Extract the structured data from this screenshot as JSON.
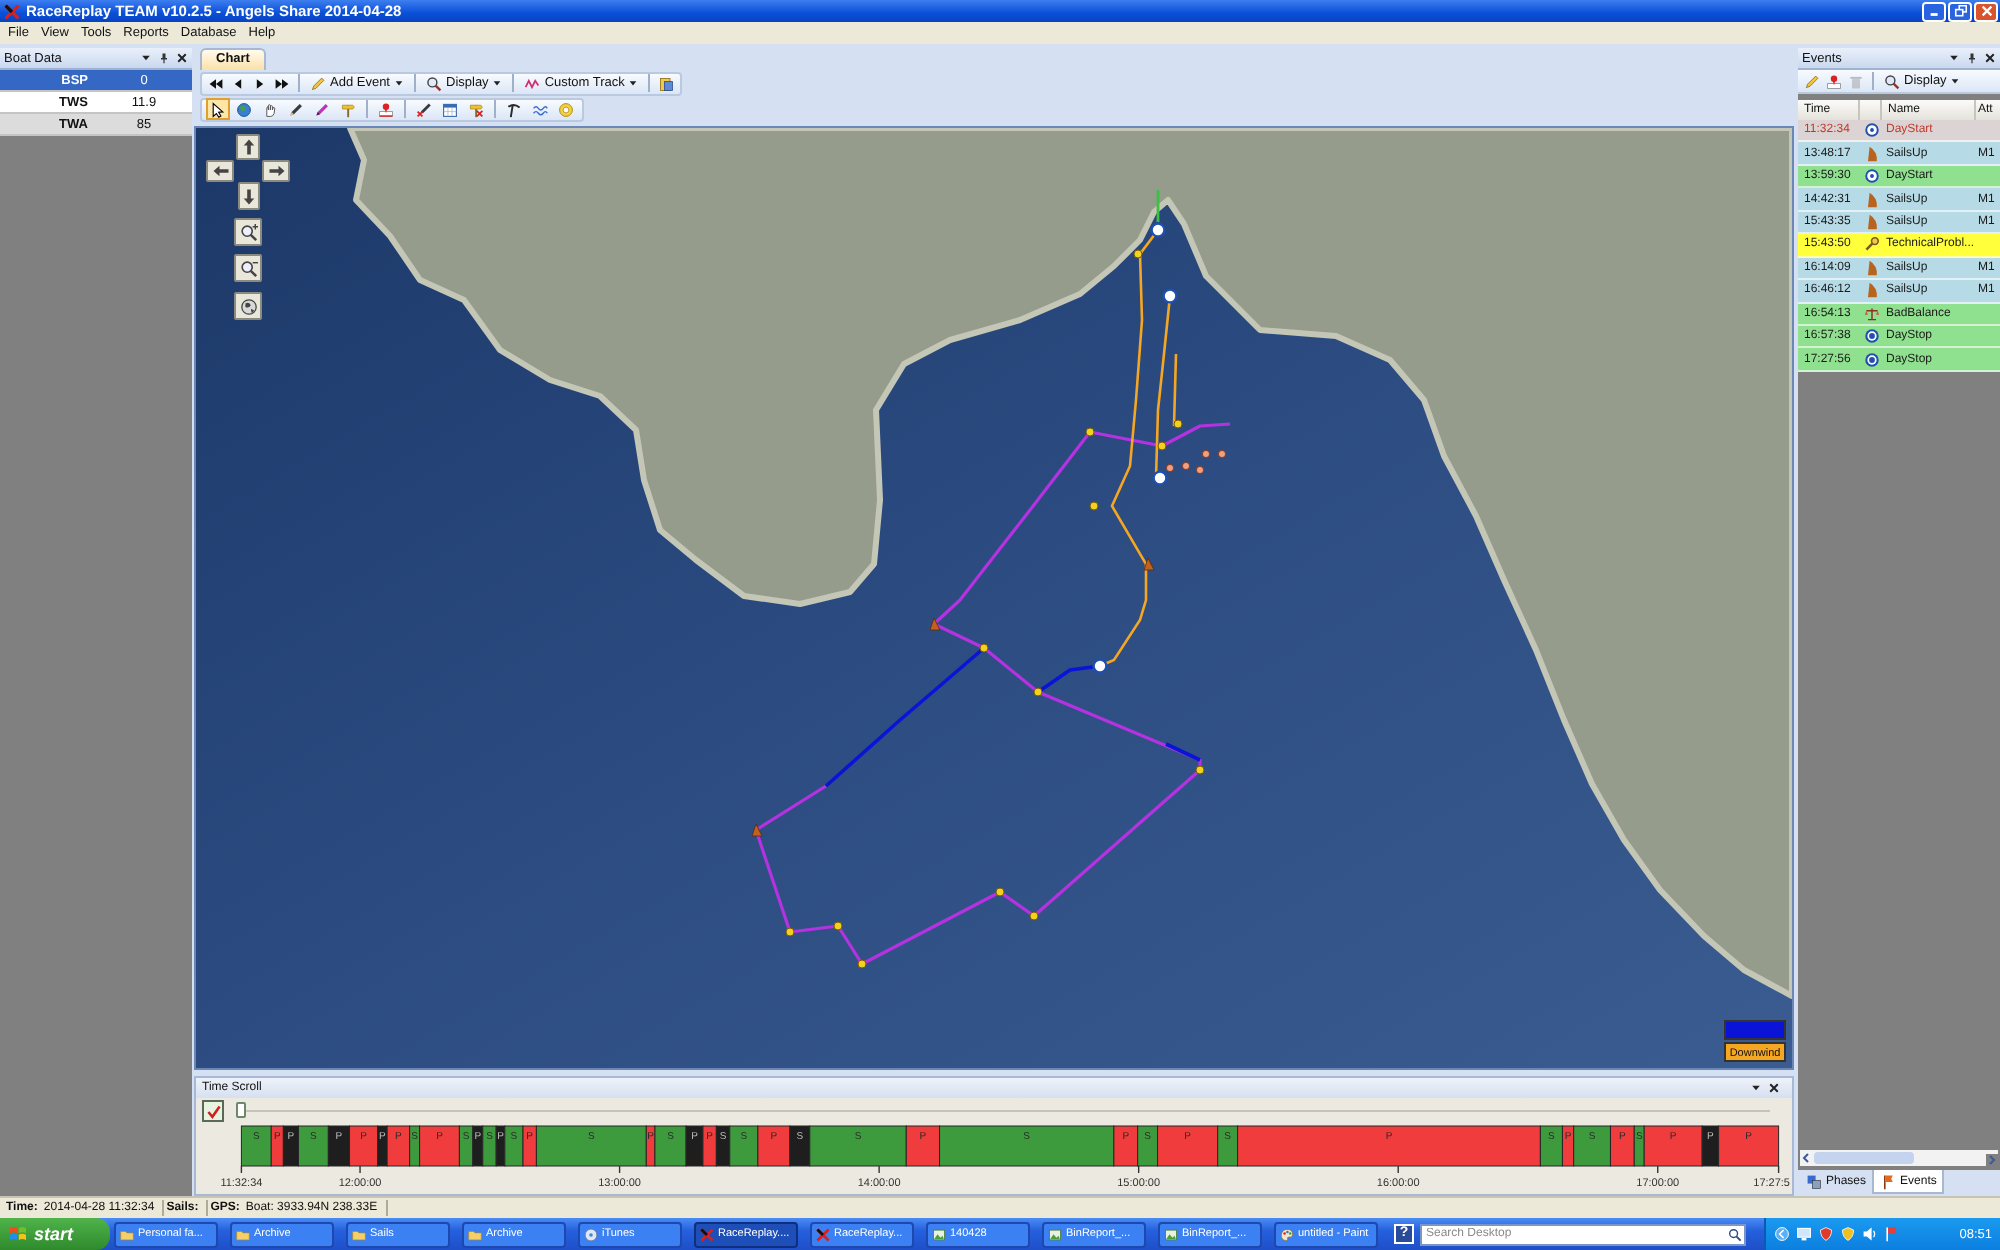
{
  "window": {
    "title": "RaceReplay TEAM v10.2.5 - Angels Share 2014-04-28"
  },
  "menu": [
    "File",
    "View",
    "Tools",
    "Reports",
    "Database",
    "Help"
  ],
  "boat_data": {
    "title": "Boat Data",
    "rows": [
      {
        "label": "BSP",
        "value": "0",
        "selected": true
      },
      {
        "label": "TWS",
        "value": "11.9",
        "selected": false
      },
      {
        "label": "TWA",
        "value": "85",
        "selected": false
      }
    ]
  },
  "chart": {
    "tabs": [
      {
        "label": "Chart",
        "selected": true
      }
    ],
    "nav_buttons": [
      {
        "kind": "first"
      },
      {
        "kind": "previous"
      },
      {
        "kind": "next"
      },
      {
        "kind": "last"
      }
    ],
    "menu_buttons": [
      {
        "label": "Add Event",
        "kind": "pencil"
      },
      {
        "label": "Display",
        "kind": "display"
      },
      {
        "label": "Custom Track",
        "kind": "track"
      }
    ],
    "extra_buttons": [
      {
        "kind": "clipboard"
      }
    ],
    "tool_groups": [
      [
        {
          "kind": "pointer",
          "selected": true
        },
        {
          "kind": "globe",
          "selected": false
        },
        {
          "kind": "hand",
          "selected": false
        },
        {
          "kind": "pencil",
          "selected": false
        },
        {
          "kind": "marker",
          "selected": false
        },
        {
          "kind": "signpost",
          "selected": false
        }
      ],
      [
        {
          "kind": "pin",
          "selected": false
        }
      ],
      [
        {
          "kind": "pencil-cross",
          "selected": false
        },
        {
          "kind": "calendar",
          "selected": false
        },
        {
          "kind": "signpost-cross",
          "selected": false
        }
      ],
      [
        {
          "kind": "pick",
          "selected": false
        },
        {
          "kind": "wave",
          "selected": false
        },
        {
          "kind": "target",
          "selected": false
        }
      ]
    ],
    "map": {
      "legend": [
        {
          "color": "#0a14d6"
        },
        {
          "label": "Downwind",
          "color": "#f5a623"
        }
      ]
    }
  },
  "time_scroll": {
    "title": "Time Scroll",
    "check_button": {
      "checked": true
    },
    "slider": {
      "level": 0
    },
    "timeline": {
      "segments": [
        {
          "label": "S",
          "color": "#3d9a3d"
        },
        {
          "label": "P",
          "color": "#f03c3c"
        },
        {
          "label": "P",
          "color": "#1e1e1e"
        },
        {
          "label": "S",
          "color": "#3d9a3d"
        },
        {
          "label": "P",
          "color": "#1e1e1e"
        },
        {
          "label": "P",
          "color": "#f03c3c"
        },
        {
          "label": "P",
          "color": "#1e1e1e"
        },
        {
          "label": "P",
          "color": "#f03c3c"
        },
        {
          "label": "S",
          "color": "#3d9a3d"
        },
        {
          "label": "P",
          "color": "#f03c3c"
        },
        {
          "label": "S",
          "color": "#3d9a3d"
        },
        {
          "label": "P",
          "color": "#1e1e1e"
        },
        {
          "label": "S",
          "color": "#3d9a3d"
        },
        {
          "label": "P",
          "color": "#1e1e1e"
        },
        {
          "label": "S",
          "color": "#3d9a3d"
        },
        {
          "label": "P",
          "color": "#f03c3c"
        },
        {
          "label": "S",
          "color": "#3d9a3d"
        },
        {
          "label": "P",
          "color": "#f03c3c"
        },
        {
          "label": "S",
          "color": "#3d9a3d"
        },
        {
          "label": "P",
          "color": "#1e1e1e"
        },
        {
          "label": "P",
          "color": "#f03c3c"
        },
        {
          "label": "S",
          "color": "#1e1e1e"
        },
        {
          "label": "S",
          "color": "#3d9a3d"
        },
        {
          "label": "P",
          "color": "#f03c3c"
        },
        {
          "label": "S",
          "color": "#1e1e1e"
        },
        {
          "label": "S",
          "color": "#3d9a3d"
        },
        {
          "label": "P",
          "color": "#f03c3c"
        },
        {
          "label": "S",
          "color": "#3d9a3d"
        },
        {
          "label": "P",
          "color": "#f03c3c"
        },
        {
          "label": "S",
          "color": "#3d9a3d"
        },
        {
          "label": "P",
          "color": "#f03c3c"
        },
        {
          "label": "S",
          "color": "#3d9a3d"
        },
        {
          "label": "P",
          "color": "#f03c3c"
        },
        {
          "label": "S",
          "color": "#3d9a3d"
        },
        {
          "label": "P",
          "color": "#f03c3c"
        },
        {
          "label": "S",
          "color": "#3d9a3d"
        },
        {
          "label": "P",
          "color": "#f03c3c"
        },
        {
          "label": "S",
          "color": "#3d9a3d"
        },
        {
          "label": "P",
          "color": "#f03c3c"
        },
        {
          "label": "P",
          "color": "#1e1e1e"
        },
        {
          "label": "P",
          "color": "#f03c3c"
        }
      ],
      "time_labels": [
        "11:32:34",
        "12:00:00",
        "13:00:00",
        "14:00:00",
        "15:00:00",
        "16:00:00",
        "17:00:00",
        "17:27:5"
      ]
    }
  },
  "events": {
    "title": "Events",
    "tools": [
      {
        "kind": "edit",
        "disabled": false
      },
      {
        "kind": "add",
        "disabled": false
      },
      {
        "kind": "delete",
        "disabled": true
      }
    ],
    "display_button": "Display",
    "columns": [
      "Time",
      "Name",
      "Att"
    ],
    "rows": [
      {
        "time": "11:32:34",
        "name": "DayStart",
        "kind": "start",
        "color": "#dcd4d4",
        "selected": true
      },
      {
        "time": "13:48:17",
        "name": "SailsUp",
        "kind": "sail",
        "attr": "M1",
        "color": "#b7dbe6",
        "selected": false
      },
      {
        "time": "13:59:30",
        "name": "DayStart",
        "kind": "start",
        "color": "#8fe08f",
        "selected": false
      },
      {
        "time": "14:42:31",
        "name": "SailsUp",
        "kind": "sail",
        "attr": "M1",
        "color": "#b7dbe6",
        "selected": false
      },
      {
        "time": "15:43:35",
        "name": "SailsUp",
        "kind": "sail",
        "attr": "M1",
        "color": "#b7dbe6",
        "selected": false
      },
      {
        "time": "15:43:50",
        "name": "TechnicalProbl...",
        "kind": "problem",
        "color": "#ffff3c",
        "selected": false
      },
      {
        "time": "16:14:09",
        "name": "SailsUp",
        "kind": "sail",
        "attr": "M1",
        "color": "#b7dbe6",
        "selected": false
      },
      {
        "time": "16:46:12",
        "name": "SailsUp",
        "kind": "sail",
        "attr": "M1",
        "color": "#b7dbe6",
        "selected": false
      },
      {
        "time": "16:54:13",
        "name": "BadBalance",
        "kind": "balance",
        "color": "#8fe08f",
        "selected": false
      },
      {
        "time": "16:57:38",
        "name": "DayStop",
        "kind": "stop",
        "color": "#8fe08f",
        "selected": false
      },
      {
        "time": "17:27:56",
        "name": "DayStop",
        "kind": "stop",
        "color": "#8fe08f",
        "selected": false
      }
    ],
    "tabs": [
      {
        "label": "Phases",
        "kind": "phases",
        "selected": false
      },
      {
        "label": "Events",
        "kind": "events",
        "selected": true
      }
    ]
  },
  "status_bar": [
    {
      "label": "Time:",
      "value": "2014-04-28 11:32:34"
    },
    {
      "label": "Sails:"
    },
    {
      "label": "GPS:",
      "value": "Boat: 3933.94N 238.33E"
    }
  ],
  "taskbar": {
    "start": "start",
    "tasks": [
      {
        "label": "Personal fa...",
        "kind": "folder",
        "selected": false
      },
      {
        "label": "Archive",
        "kind": "folder",
        "selected": false
      },
      {
        "label": "Sails",
        "kind": "folder",
        "selected": false
      },
      {
        "label": "Archive",
        "kind": "folder",
        "selected": false
      },
      {
        "label": "iTunes",
        "kind": "music",
        "selected": false
      },
      {
        "label": "RaceReplay....",
        "kind": "app",
        "selected": true
      },
      {
        "label": "RaceReplay...",
        "kind": "app",
        "selected": false
      },
      {
        "label": "140428",
        "kind": "image",
        "selected": false
      },
      {
        "label": "BinReport_...",
        "kind": "image",
        "selected": false
      },
      {
        "label": "BinReport_...",
        "kind": "image",
        "selected": false
      },
      {
        "label": "untitled - Paint",
        "kind": "paint",
        "selected": false
      }
    ],
    "help": "?",
    "search": {
      "placeholder": "Search Desktop"
    },
    "clock": "08:51"
  }
}
